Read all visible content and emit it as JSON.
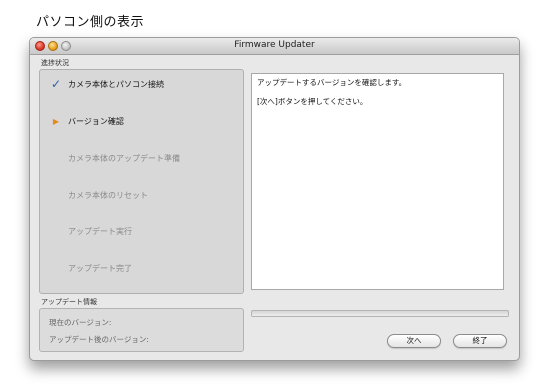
{
  "page": {
    "heading": "パソコン側の表示"
  },
  "window": {
    "title": "Firmware Updater"
  },
  "progress_section": {
    "label": "進捗状況",
    "steps": [
      {
        "label": "カメラ本体とパソコン接続",
        "state": "done"
      },
      {
        "label": "バージョン確認",
        "state": "current"
      },
      {
        "label": "カメラ本体のアップデート準備",
        "state": "pending"
      },
      {
        "label": "カメラ本体のリセット",
        "state": "pending"
      },
      {
        "label": "アップデート実行",
        "state": "pending"
      },
      {
        "label": "アップデート完了",
        "state": "pending"
      }
    ]
  },
  "message": {
    "line1": "アップデートするバージョンを確認します。",
    "line2": "[次へ]ボタンを押してください。"
  },
  "update_info": {
    "label": "アップデート情報",
    "current_version_label": "現在のバージョン:",
    "updated_version_label": "アップデート後のバージョン:"
  },
  "progress_bar": {
    "value_percent": 0
  },
  "buttons": {
    "next_label": "次へ",
    "finish_label": "終了"
  },
  "colors": {
    "check": "#2d5fa8",
    "current_arrow": "#e58a1c",
    "pending_text": "#8a8a8a"
  }
}
